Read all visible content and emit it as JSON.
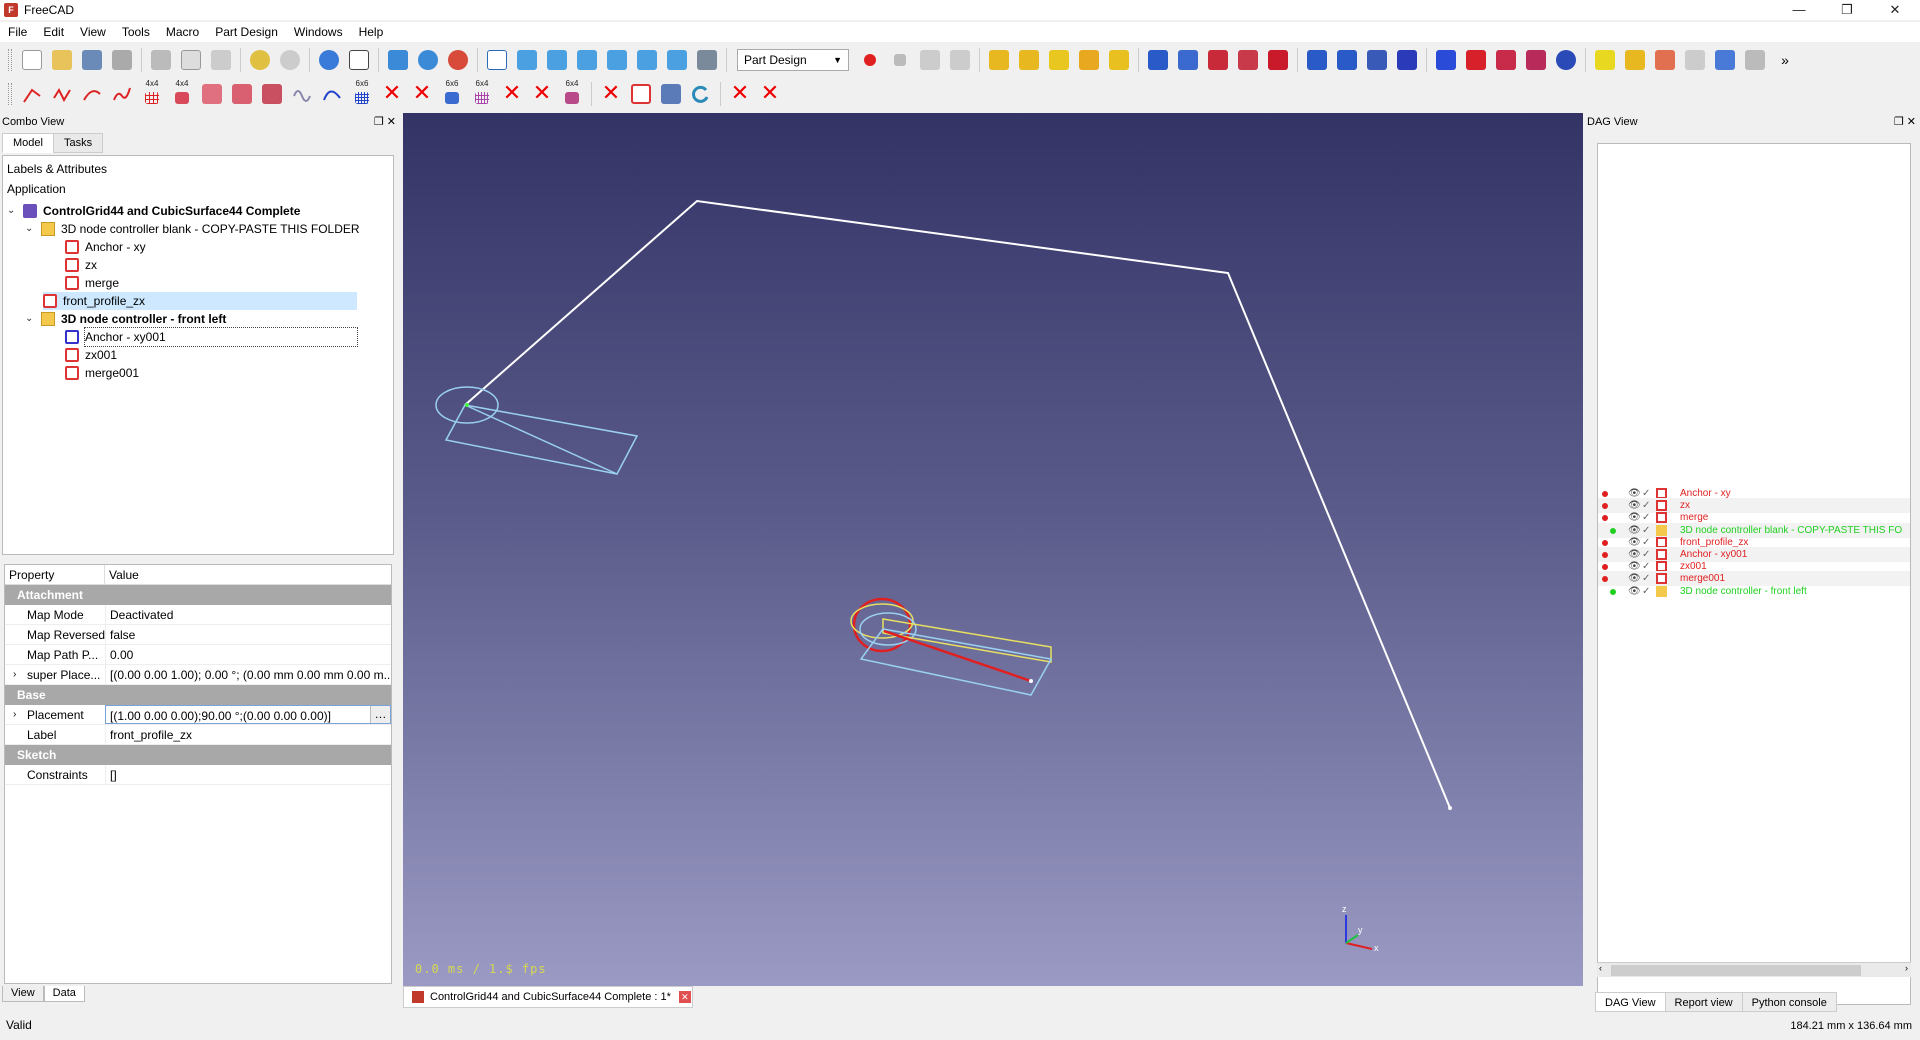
{
  "window": {
    "title": "FreeCAD",
    "minimize": "—",
    "maximize": "❐",
    "close": "✕"
  },
  "menu": [
    "File",
    "Edit",
    "View",
    "Tools",
    "Macro",
    "Part Design",
    "Windows",
    "Help"
  ],
  "toolbar": {
    "workbench": "Part Design",
    "grid_labels": [
      "4x4",
      "4x4",
      "6x6",
      "6x6",
      "6x4",
      "6x4"
    ],
    "more": "»"
  },
  "combo": {
    "title": "Combo View",
    "tabs": [
      "Model",
      "Tasks"
    ],
    "tree_header1": "Labels & Attributes",
    "tree_header2": "Application",
    "items": [
      "ControlGrid44 and CubicSurface44 Complete",
      "3D node controller blank - COPY-PASTE THIS FOLDER",
      "Anchor - xy",
      "zx",
      "merge",
      "front_profile_zx",
      "3D node controller - front left",
      "Anchor - xy001",
      "zx001",
      "merge001"
    ]
  },
  "props": {
    "col_property": "Property",
    "col_value": "Value",
    "groups": [
      "Attachment",
      "Base",
      "Sketch"
    ],
    "rows": [
      {
        "name": "Map Mode",
        "value": "Deactivated"
      },
      {
        "name": "Map Reversed",
        "value": "false"
      },
      {
        "name": "Map Path P...",
        "value": "0.00"
      },
      {
        "name": "super Place...",
        "value": "[(0.00 0.00 1.00); 0.00 °; (0.00 mm  0.00 mm  0.00 m..."
      },
      {
        "name": "Placement",
        "value": "[(1.00 0.00 0.00);90.00 °;(0.00 0.00 0.00)]"
      },
      {
        "name": "Label",
        "value": "front_profile_zx"
      },
      {
        "name": "Constraints",
        "value": "[]"
      }
    ],
    "tabs": [
      "View",
      "Data"
    ]
  },
  "view3d": {
    "fps": "0.0 ms / 1.$ fps",
    "axis_x": "x",
    "axis_y": "y",
    "axis_z": "z",
    "doc_tab": "ControlGrid44 and CubicSurface44 Complete : 1*"
  },
  "dag": {
    "title": "DAG View",
    "items": [
      {
        "label": "Anchor - xy",
        "color": "#e02020"
      },
      {
        "label": "zx",
        "color": "#e02020"
      },
      {
        "label": "merge",
        "color": "#e02020"
      },
      {
        "label": "3D node controller blank - COPY-PASTE THIS FO",
        "color": "#20d020"
      },
      {
        "label": "front_profile_zx",
        "color": "#e02020"
      },
      {
        "label": "Anchor - xy001",
        "color": "#e02020"
      },
      {
        "label": "zx001",
        "color": "#e02020"
      },
      {
        "label": "merge001",
        "color": "#e02020"
      },
      {
        "label": "3D node controller - front left",
        "color": "#20d020"
      }
    ],
    "tabs": [
      "DAG View",
      "Report view",
      "Python console"
    ]
  },
  "status": {
    "left": "Valid",
    "right": "184.21 mm x 136.64 mm"
  }
}
